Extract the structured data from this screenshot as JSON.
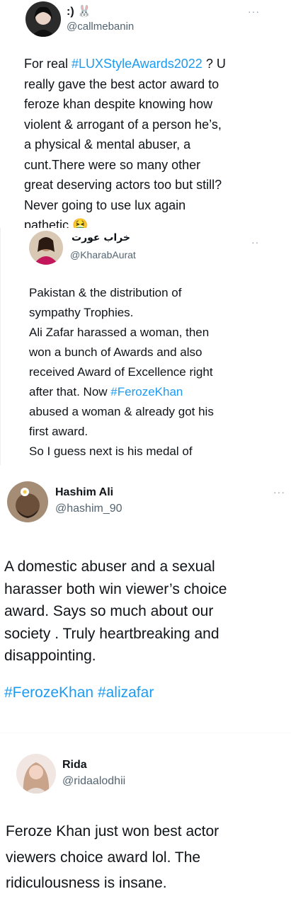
{
  "tweets": [
    {
      "name": ":) 🐰",
      "handle": "@callmebanin",
      "more": "···",
      "text_a": "For real ",
      "tag_a": "#LUXStyleAwards2022",
      "text_b": " ? U\nreally gave the best actor award to\nferoze khan despite knowing how\nviolent & arrogant of a person he’s,\na physical & mental abuser, a\ncunt.There were so many other\ngreat deserving actors too but still?\nNever going to use lux again\npathetic ",
      "emoji": "🤮"
    },
    {
      "name": "خراب عورت",
      "handle": "@KharabAurat",
      "more": "··",
      "text_a": "Pakistan & the distribution of\nsympathy Trophies.\nAli Zafar harassed a woman, then\nwon a bunch of Awards and also\nreceived Award of Excellence right\nafter that. Now ",
      "tag_a": "#FerozeKhan",
      "text_b": "\nabused a woman & already got his\nfirst award.\nSo I guess next is his medal of\nexcellence?"
    },
    {
      "name": "Hashim Ali",
      "handle": "@hashim_90",
      "more": "···",
      "text_a": "A domestic abuser and a sexual\nharasser both win viewer’s choice\naward. Says so much about our\nsociety . Truly heartbreaking and\ndisappointing.",
      "tag_a": "#FerozeKhan",
      "tag_b": "#alizafar"
    },
    {
      "name": "Rida",
      "handle": "@ridaalodhii",
      "text_a": "Feroze Khan just won best actor\nviewers choice award lol. The\nridiculousness is insane."
    }
  ],
  "colors": {
    "hashtag": "#1d9bf0",
    "handle": "#536471",
    "text": "#0f1419"
  }
}
